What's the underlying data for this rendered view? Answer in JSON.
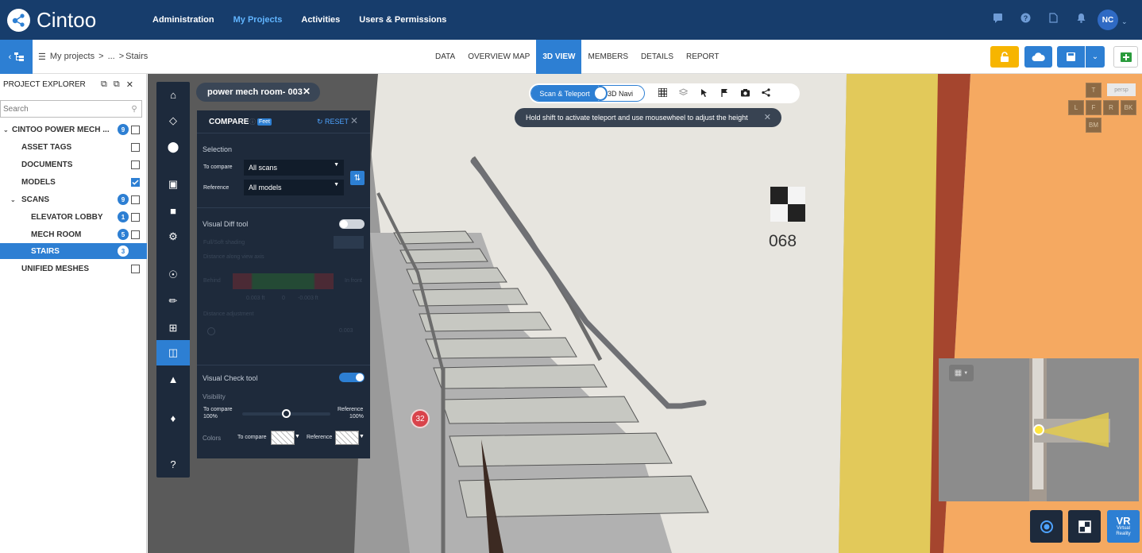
{
  "app": {
    "name": "Cintoo"
  },
  "nav": {
    "items": [
      "Administration",
      "My Projects",
      "Activities",
      "Users & Permissions"
    ],
    "active": "My Projects"
  },
  "user": {
    "initials": "NC"
  },
  "breadcrumb": {
    "root": "My projects",
    "sep1": ">",
    "ellipsis": "...",
    "sep2": ">",
    "current": "Stairs"
  },
  "tabs": {
    "items": [
      "DATA",
      "OVERVIEW MAP",
      "3D VIEW",
      "MEMBERS",
      "DETAILS",
      "REPORT"
    ],
    "active": "3D VIEW"
  },
  "explorer": {
    "title": "PROJECT EXPLORER",
    "search_placeholder": "Search",
    "rows": [
      {
        "label": "CINTOO POWER MECH ...",
        "badge": "9",
        "checked": false,
        "level": 0,
        "caret": true
      },
      {
        "label": "ASSET TAGS",
        "badge": "",
        "checked": false,
        "level": 1
      },
      {
        "label": "DOCUMENTS",
        "badge": "",
        "checked": false,
        "level": 1
      },
      {
        "label": "MODELS",
        "badge": "",
        "checked": true,
        "level": 1
      },
      {
        "label": "SCANS",
        "badge": "9",
        "checked": false,
        "level": 1,
        "caret": true
      },
      {
        "label": "ELEVATOR LOBBY",
        "badge": "1",
        "checked": false,
        "level": 2
      },
      {
        "label": "MECH ROOM",
        "badge": "5",
        "checked": false,
        "level": 2
      },
      {
        "label": "STAIRS",
        "badge": "3",
        "checked": false,
        "level": 2,
        "selected": true
      },
      {
        "label": "UNIFIED MESHES",
        "badge": "",
        "checked": false,
        "level": 1
      }
    ]
  },
  "scan_tag": {
    "label": "power mech room- 003"
  },
  "compare": {
    "title": "COMPARE",
    "unit": "Feet",
    "reset": "RESET",
    "selection": "Selection",
    "to_compare_label": "To compare",
    "to_compare_value": "All scans",
    "reference_label": "Reference",
    "reference_value": "All models",
    "visual_diff": "Visual Diff tool",
    "visual_diff_on": false,
    "faded": {
      "shading": "Full/Soft shading",
      "distance_view": "Distance along view axis",
      "behind": "Behind",
      "infront": "In front",
      "v1": "0.003 ft",
      "v2": "0",
      "v3": "-0.003 ft",
      "adjust": "Distance adjustment",
      "val": "0.003"
    },
    "visual_check": "Visual Check tool",
    "visual_check_on": true,
    "visibility": "Visibility",
    "vis_left": "To compare",
    "vis_left_pct": "100%",
    "vis_right": "Reference",
    "vis_right_pct": "100%",
    "visibility_level": 0.5,
    "colors": "Colors",
    "colors_to_compare": "To compare",
    "colors_reference": "Reference"
  },
  "view_modes": {
    "a": "Scan & Teleport",
    "b": "3D Navi"
  },
  "hint": "Hold shift to activate teleport and use mousewheel to adjust the height",
  "cube": {
    "t": "T",
    "persp": "persp",
    "l": "L",
    "f": "F",
    "r": "R",
    "bk": "BK",
    "bm": "BM"
  },
  "scene": {
    "tag_number": "068",
    "marker": "32"
  },
  "vr": {
    "line1": "VR",
    "line2": "Virtual",
    "line3": "Reality"
  },
  "colors": {
    "navy": "#173d6c",
    "accent": "#2d7fd3",
    "panel": "#1e2a3b",
    "yellow": "#f7b500"
  }
}
